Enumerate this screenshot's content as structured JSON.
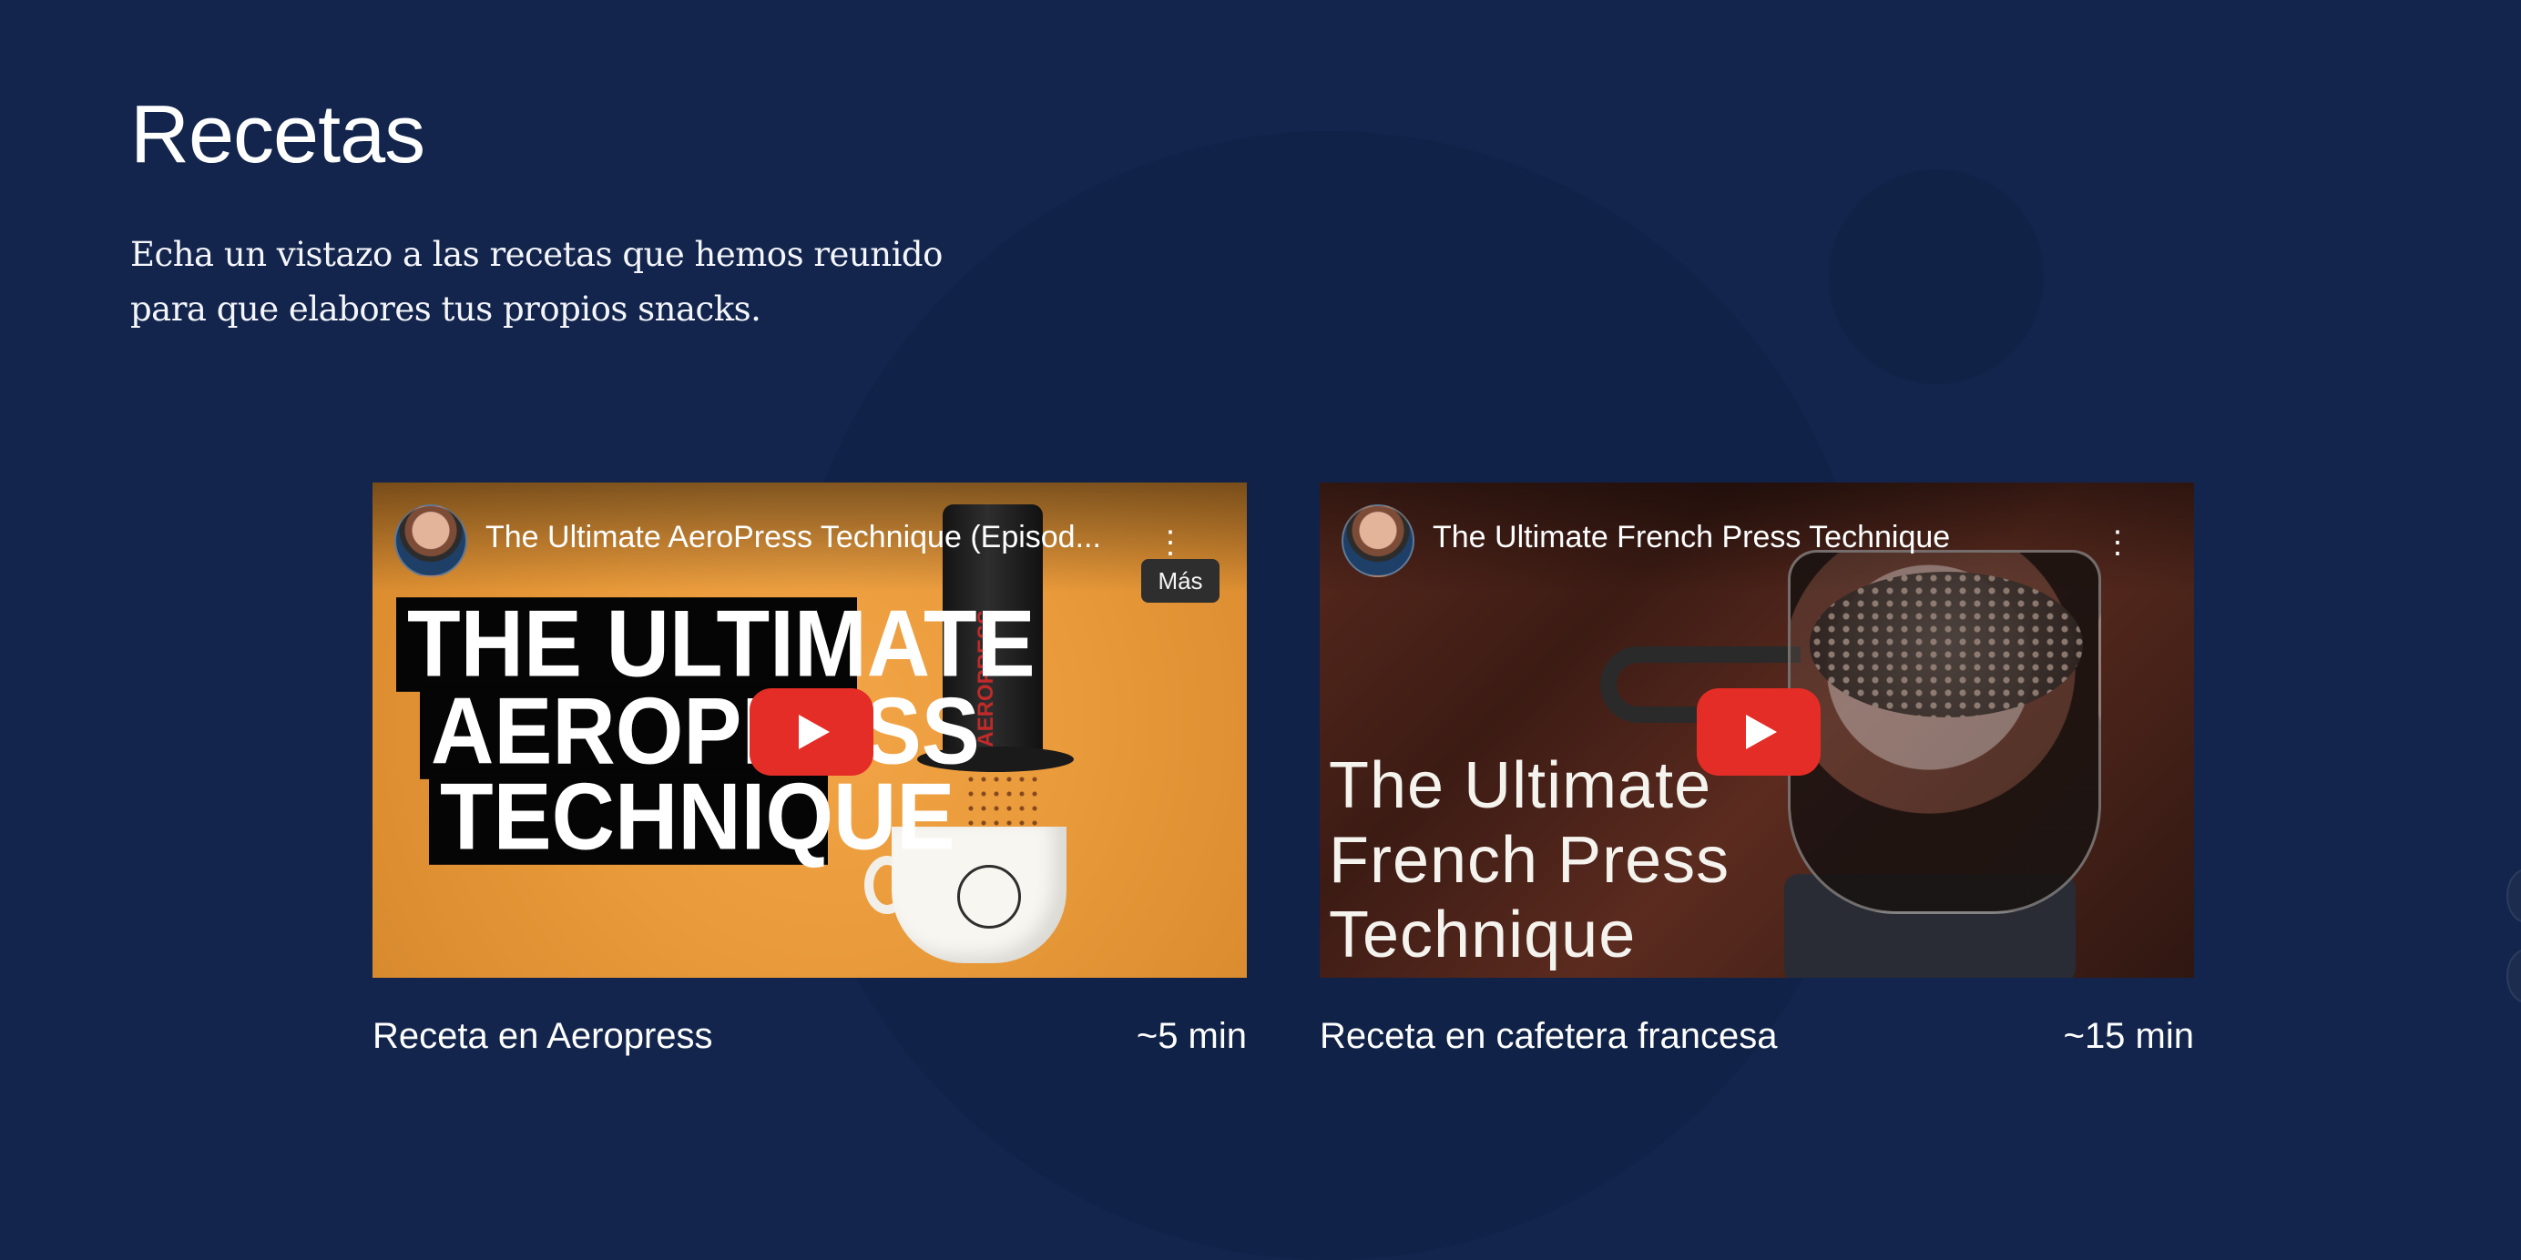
{
  "page": {
    "title": "Recetas",
    "intro": "Echa un vistazo a las recetas que hemos reunido para que elabores tus propios snacks."
  },
  "recipes": [
    {
      "video": {
        "title": "The Ultimate AeroPress Technique (Episod...",
        "menu_icon": "more-vertical-icon",
        "menu_tooltip": "Más",
        "thumbnail_lines": [
          "THE ULTIMATE",
          "AEROPRESS",
          "TECHNIQUE"
        ],
        "device_label": "AEROPRESS"
      },
      "name": "Receta en Aeropress",
      "duration": "~5 min"
    },
    {
      "video": {
        "title": "The Ultimate French Press Technique",
        "menu_icon": "more-vertical-icon",
        "thumbnail_title": "The Ultimate French Press Technique"
      },
      "name": "Receta en cafetera francesa",
      "duration": "~15 min"
    }
  ],
  "colors": {
    "background": "#13254d",
    "youtube_red": "#e52d27",
    "text": "#ffffff"
  }
}
